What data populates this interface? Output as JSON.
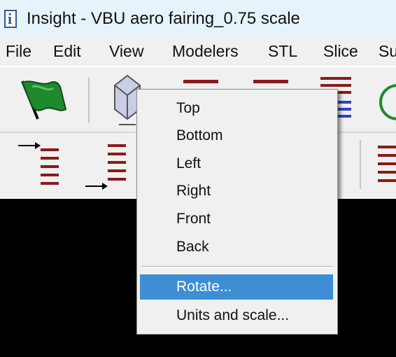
{
  "window": {
    "title": "Insight - VBU aero fairing_0.75 scale",
    "icon_glyph": "i"
  },
  "menubar": {
    "items": [
      "File",
      "Edit",
      "View",
      "Modelers",
      "STL",
      "Slice",
      "Su"
    ]
  },
  "toolbar": {
    "row1_icons": [
      "flag-icon",
      "view-cube-icon",
      "layers-icon",
      "layers-icon",
      "layers-blue-icon",
      "green-circle-icon"
    ],
    "row2_icons": [
      "layer-arrow-top-icon",
      "layer-arrow-bottom-icon",
      "layers-icon"
    ]
  },
  "context_menu": {
    "items": [
      "Top",
      "Bottom",
      "Left",
      "Right",
      "Front",
      "Back"
    ],
    "rotate": "Rotate...",
    "units": "Units and scale...",
    "highlighted": "Rotate..."
  },
  "colors": {
    "title_bg": "#e7f3fa",
    "chrome_bg": "#f0f0f0",
    "layer_red": "#8b1a1a",
    "layer_blue": "#2a45c9",
    "highlight": "#3d8ed3",
    "viewport": "#000000"
  }
}
